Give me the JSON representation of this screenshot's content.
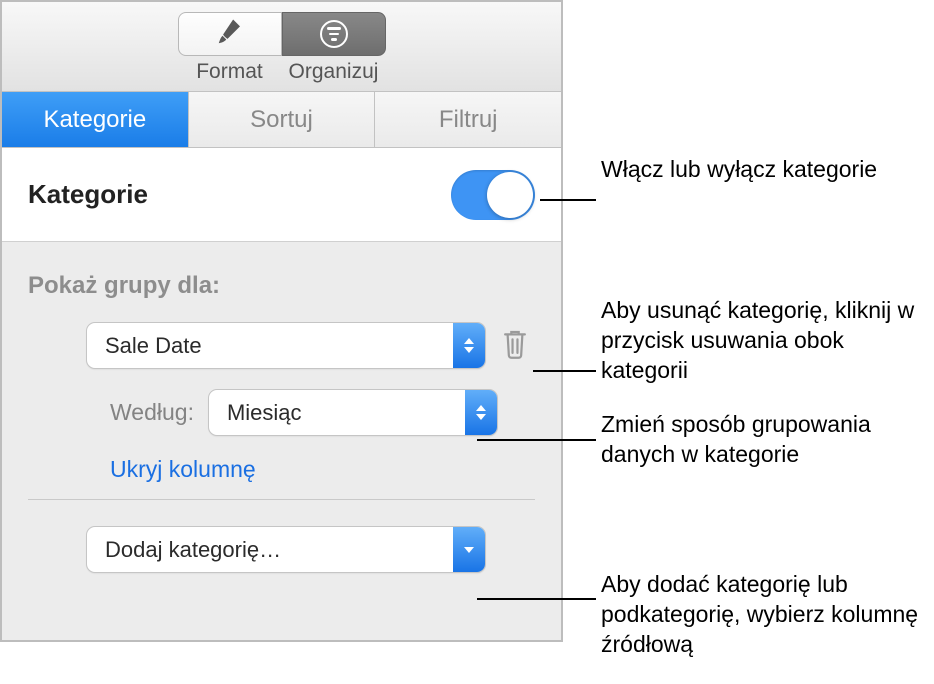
{
  "toolbar": {
    "format_label": "Format",
    "organize_label": "Organizuj"
  },
  "tabs": {
    "categories": "Kategorie",
    "sort": "Sortuj",
    "filter": "Filtruj"
  },
  "section": {
    "title": "Kategorie",
    "toggle_on": true
  },
  "groups": {
    "show_label": "Pokaż grupy dla:",
    "source_value": "Sale Date",
    "by_label": "Według:",
    "by_value": "Miesiąc",
    "hide_column": "Ukryj kolumnę",
    "add_category": "Dodaj kategorię…"
  },
  "callouts": {
    "c1": "Włącz lub wyłącz kategorie",
    "c2": "Aby usunąć kategorię, kliknij w przycisk usuwania obok kategorii",
    "c3": "Zmień sposób grupowania danych w kategorie",
    "c4": "Aby dodać kategorię lub podkategorię, wybierz kolumnę źródłową"
  }
}
